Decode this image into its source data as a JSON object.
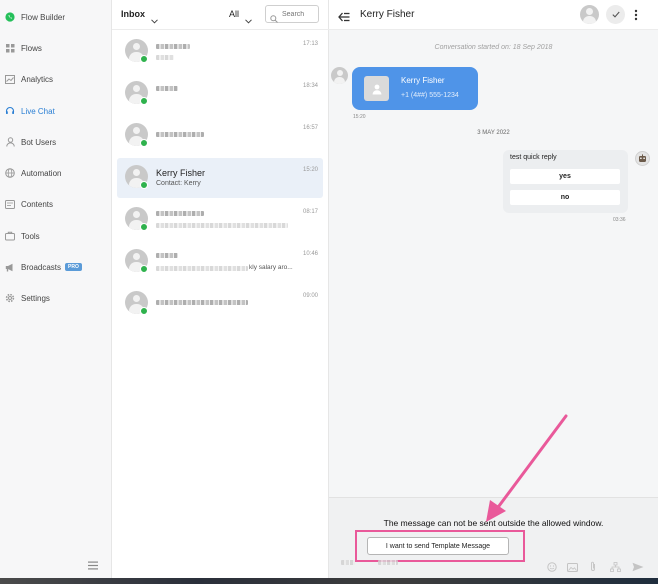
{
  "sidebar": {
    "items": [
      {
        "label": "Flow Builder",
        "icon": "whatsapp-icon"
      },
      {
        "label": "Flows",
        "icon": "grid-icon"
      },
      {
        "label": "Analytics",
        "icon": "analytics-icon"
      },
      {
        "label": "Live Chat",
        "icon": "headset-icon",
        "active": true
      },
      {
        "label": "Bot Users",
        "icon": "user-icon"
      },
      {
        "label": "Automation",
        "icon": "globe-icon"
      },
      {
        "label": "Contents",
        "icon": "contents-icon"
      },
      {
        "label": "Tools",
        "icon": "tools-icon"
      },
      {
        "label": "Broadcasts",
        "icon": "megaphone-icon",
        "badge": "PRO"
      },
      {
        "label": "Settings",
        "icon": "gear-icon"
      }
    ]
  },
  "inbox": {
    "title": "Inbox",
    "filter": "All",
    "search_placeholder": "Search",
    "conversations": [
      {
        "time": "17:13"
      },
      {
        "time": "18:34"
      },
      {
        "time": "16:57"
      },
      {
        "time": "15:20",
        "name": "Kerry Fisher",
        "subtitle": "Contact: Kerry",
        "selected": true
      },
      {
        "time": "08:17"
      },
      {
        "time": "10:46",
        "snippet": "kly salary aro..."
      },
      {
        "time": "09:00"
      }
    ]
  },
  "chat": {
    "contact_name": "Kerry Fisher",
    "conversation_started": "Conversation started on: 18 Sep 2018",
    "contact_card": {
      "name": "Kerry Fisher",
      "phone": "+1 (4##) 555-1234",
      "time": "15:20"
    },
    "date_separator": "3 MAY 2022",
    "quick_reply": {
      "text": "test quick reply",
      "options": [
        "yes",
        "no"
      ],
      "time": "03:36"
    },
    "window_message": "The message can not be sent outside the allowed window.",
    "template_button": "I want to send Template Message"
  },
  "colors": {
    "accent": "#2a7fd4",
    "bubble_blue": "#4f94e8",
    "whatsapp_green": "#2fb24d",
    "highlight_pink": "#e9599a"
  }
}
